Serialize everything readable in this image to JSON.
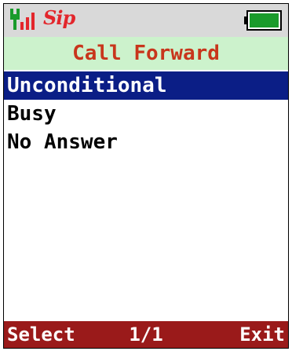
{
  "status_bar": {
    "signal_icon": "signal-strength-icon",
    "sip_label": "Sip",
    "battery_icon": "battery-full-icon",
    "accent_color": "#e3262c",
    "battery_color": "#1a9b2b"
  },
  "title": "Call Forward",
  "menu": {
    "items": [
      {
        "label": "Unconditional",
        "selected": true
      },
      {
        "label": "Busy",
        "selected": false
      },
      {
        "label": "No Answer",
        "selected": false
      }
    ]
  },
  "softkeys": {
    "left": "Select",
    "page": "1/1",
    "right": "Exit"
  },
  "colors": {
    "title_bg": "#ccf2cc",
    "title_text": "#c8361c",
    "selection_bg": "#0b1e86",
    "softkey_bg": "#9a1a1a"
  }
}
